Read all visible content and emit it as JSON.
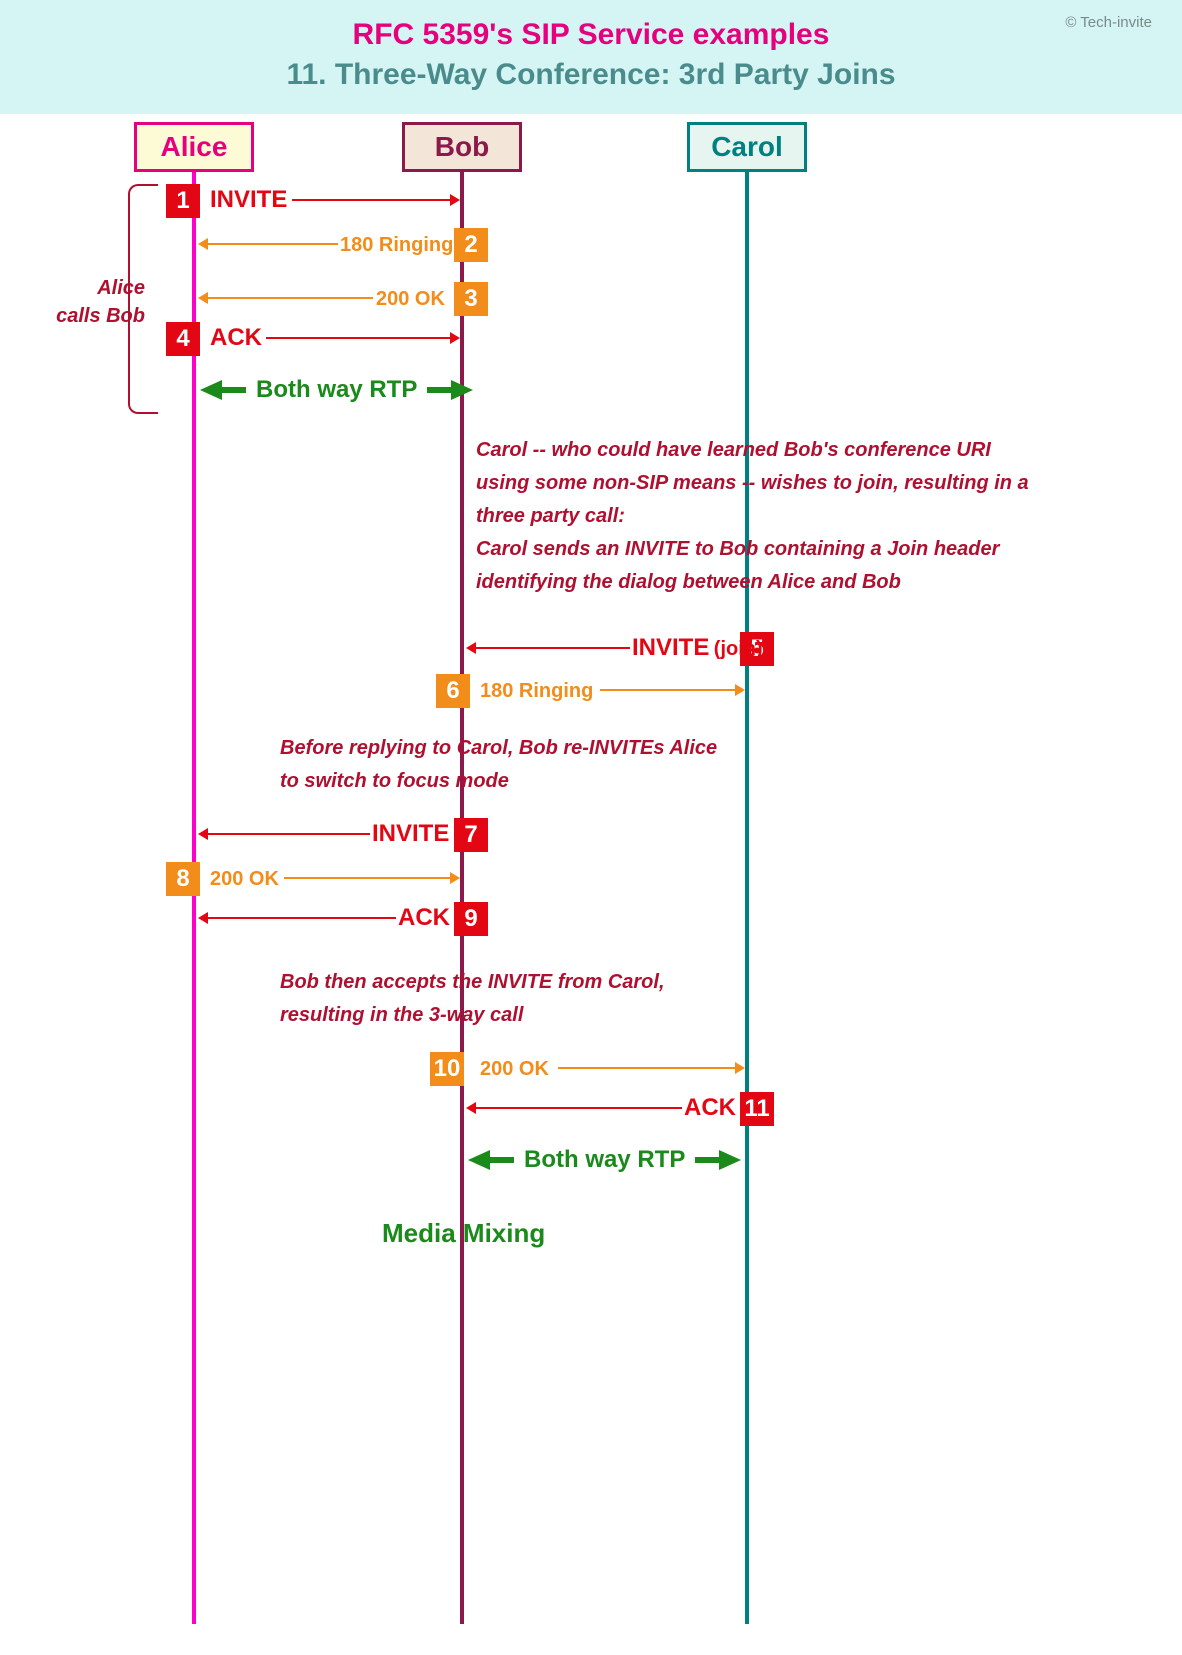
{
  "copyright": "© Tech-invite",
  "title1": "RFC 5359's SIP Service examples",
  "title2": "11. Three-Way Conference: 3rd Party Joins",
  "actors": {
    "alice": "Alice",
    "bob": "Bob",
    "carol": "Carol"
  },
  "side_label": "Alice calls Bob",
  "steps": {
    "s1": "1",
    "s2": "2",
    "s3": "3",
    "s4": "4",
    "s5": "5",
    "s6": "6",
    "s7": "7",
    "s8": "8",
    "s9": "9",
    "s10": "10",
    "s11": "11"
  },
  "msgs": {
    "invite": "INVITE",
    "ringing": "180 Ringing",
    "ok": "200 OK",
    "ack": "ACK",
    "invite_join_a": "INVITE",
    "invite_join_b": "(join)"
  },
  "rtp": "Both way RTP",
  "note1": "Carol -- who could have learned Bob's conference URI using some non-SIP means -- wishes to join, resulting in a three party call:\nCarol sends an INVITE to Bob containing a Join header identifying the dialog between Alice and Bob",
  "note2": "Before replying to Carol, Bob re-INVITEs Alice to switch to focus mode",
  "note3": "Bob then accepts the INVITE from Carol, resulting in the 3-way call",
  "media_mixing": "Media Mixing"
}
